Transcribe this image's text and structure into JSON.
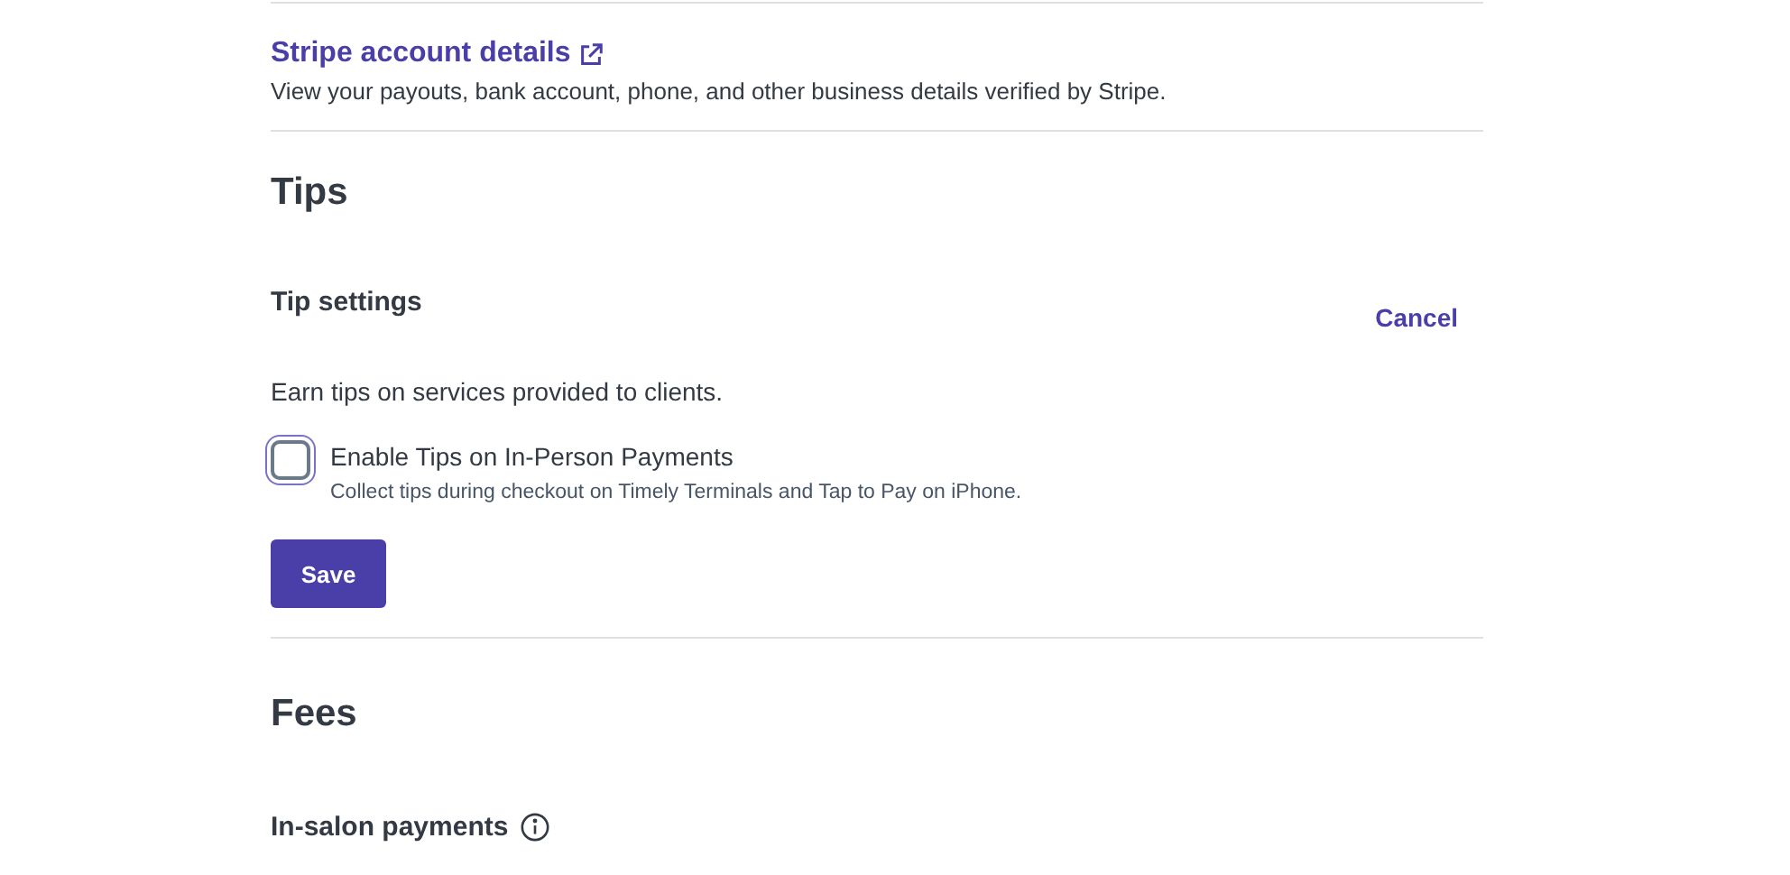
{
  "stripe_account": {
    "link": "Stripe account details",
    "description": "View your payouts, bank account, phone, and other business details verified by Stripe."
  },
  "tips": {
    "heading": "Tips",
    "settings_title": "Tip settings",
    "cancel": "Cancel",
    "description": "Earn tips on services provided to clients.",
    "option": {
      "label": "Enable Tips on In-Person Payments",
      "hint": "Collect tips during checkout on Timely Terminals and Tap to Pay on iPhone.",
      "checked": false
    },
    "save": "Save"
  },
  "fees": {
    "heading": "Fees",
    "subheading": "In-salon payments"
  }
}
